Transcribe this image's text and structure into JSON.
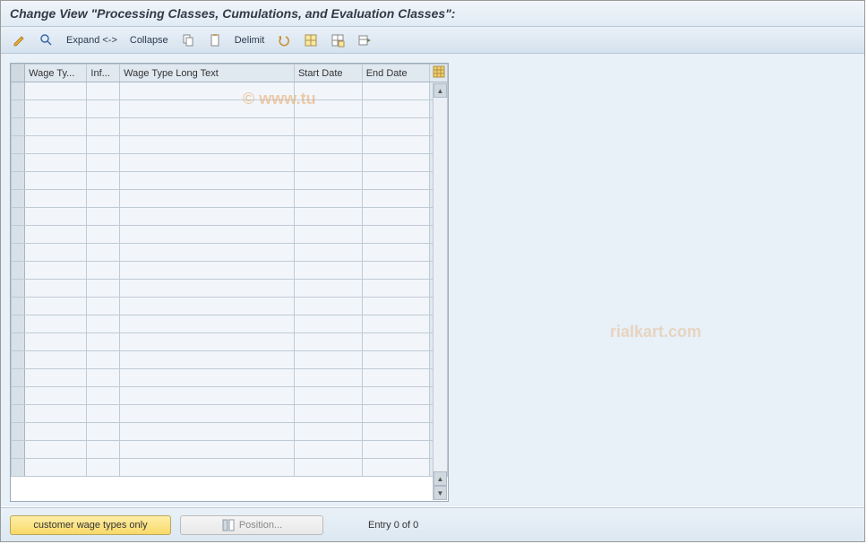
{
  "title": "Change View \"Processing Classes, Cumulations, and Evaluation Classes\":",
  "toolbar": {
    "expand": "Expand <->",
    "collapse": "Collapse",
    "delimit": "Delimit"
  },
  "table": {
    "columns": {
      "wage_type": "Wage Ty...",
      "inf": "Inf...",
      "wage_type_long": "Wage Type Long Text",
      "start_date": "Start Date",
      "end_date": "End Date"
    },
    "rows": []
  },
  "footer": {
    "customer_wage_types": "customer wage types only",
    "position": "Position...",
    "entry_status": "Entry 0 of 0"
  },
  "watermark_left": "© www.tu",
  "watermark_right": "rialkart.com"
}
